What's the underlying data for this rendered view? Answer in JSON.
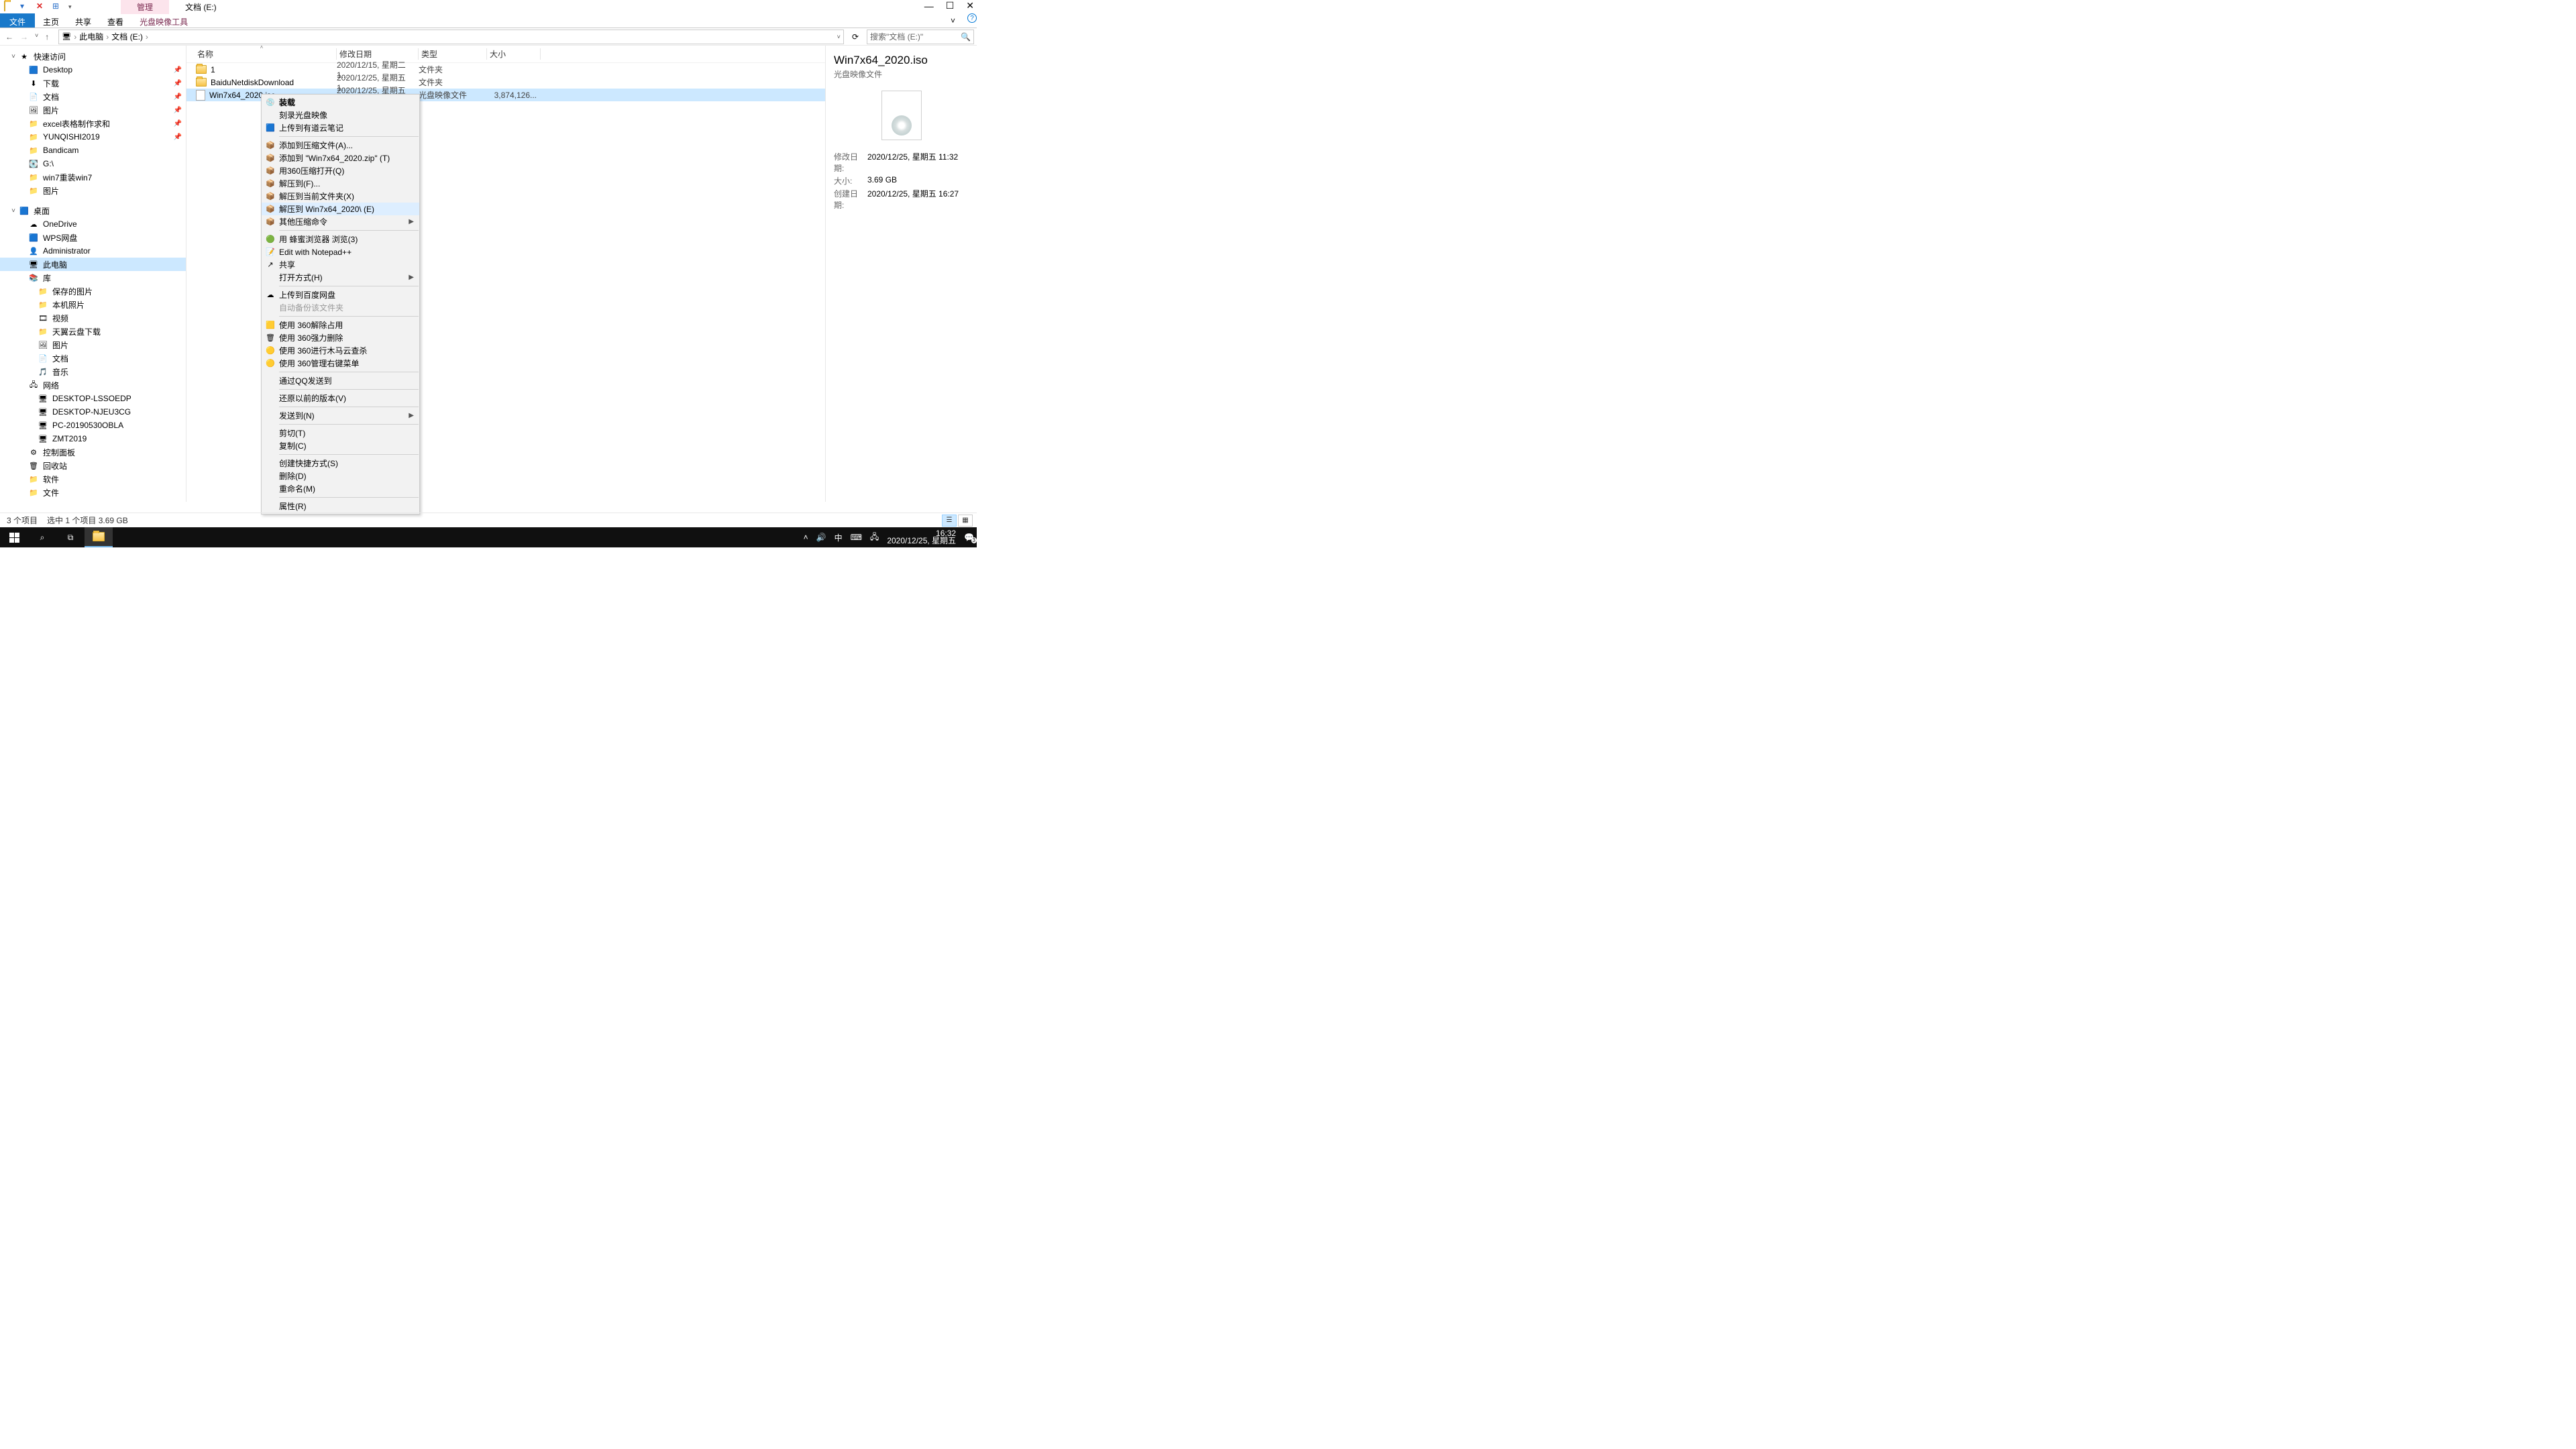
{
  "titlebar": {
    "ctx_tab": "管理",
    "window_title": "文档 (E:)"
  },
  "ribbon": {
    "file": "文件",
    "home": "主页",
    "share": "共享",
    "view": "查看",
    "disc_tools": "光盘映像工具"
  },
  "address": {
    "root": "此电脑",
    "segment": "文档 (E:)",
    "search_placeholder": "搜索\"文档 (E:)\""
  },
  "nav": {
    "quick": {
      "label": "快速访问"
    },
    "items_quick": [
      {
        "label": "Desktop",
        "icon": "🟦",
        "pin": true
      },
      {
        "label": "下载",
        "icon": "⬇",
        "pin": true
      },
      {
        "label": "文档",
        "icon": "📄",
        "pin": true
      },
      {
        "label": "图片",
        "icon": "🖼",
        "pin": true
      },
      {
        "label": "excel表格制作求和",
        "icon": "📁",
        "pin": true
      },
      {
        "label": "YUNQISHI2019",
        "icon": "📁",
        "pin": true
      },
      {
        "label": "Bandicam",
        "icon": "📁"
      },
      {
        "label": "G:\\",
        "icon": "💽"
      },
      {
        "label": "win7重装win7",
        "icon": "📁"
      },
      {
        "label": "图片",
        "icon": "📁"
      }
    ],
    "desktop": {
      "label": "桌面"
    },
    "items_desktop": [
      {
        "label": "OneDrive",
        "icon": "☁"
      },
      {
        "label": "WPS网盘",
        "icon": "🟦"
      },
      {
        "label": "Administrator",
        "icon": "👤"
      },
      {
        "label": "此电脑",
        "icon": "🖥",
        "selected": true
      },
      {
        "label": "库",
        "icon": "📚"
      },
      {
        "label": "保存的图片",
        "icon": "📁",
        "lvl": 2
      },
      {
        "label": "本机照片",
        "icon": "📁",
        "lvl": 2
      },
      {
        "label": "视频",
        "icon": "🎞",
        "lvl": 2
      },
      {
        "label": "天翼云盘下载",
        "icon": "📁",
        "lvl": 2
      },
      {
        "label": "图片",
        "icon": "🖼",
        "lvl": 2
      },
      {
        "label": "文档",
        "icon": "📄",
        "lvl": 2
      },
      {
        "label": "音乐",
        "icon": "🎵",
        "lvl": 2
      },
      {
        "label": "网络",
        "icon": "🖧"
      },
      {
        "label": "DESKTOP-LSSOEDP",
        "icon": "🖥",
        "lvl": 2
      },
      {
        "label": "DESKTOP-NJEU3CG",
        "icon": "🖥",
        "lvl": 2
      },
      {
        "label": "PC-20190530OBLA",
        "icon": "🖥",
        "lvl": 2
      },
      {
        "label": "ZMT2019",
        "icon": "🖥",
        "lvl": 2
      },
      {
        "label": "控制面板",
        "icon": "⚙"
      },
      {
        "label": "回收站",
        "icon": "🗑"
      },
      {
        "label": "软件",
        "icon": "📁"
      },
      {
        "label": "文件",
        "icon": "📁"
      }
    ]
  },
  "columns": {
    "name": "名称",
    "date": "修改日期",
    "type": "类型",
    "size": "大小"
  },
  "rows": [
    {
      "name": "1",
      "date": "2020/12/15, 星期二 1...",
      "type": "文件夹",
      "size": "",
      "icon": "folder"
    },
    {
      "name": "BaiduNetdiskDownload",
      "date": "2020/12/25, 星期五 1...",
      "type": "文件夹",
      "size": "",
      "icon": "folder"
    },
    {
      "name": "Win7x64_2020.iso",
      "date": "2020/12/25, 星期五 1...",
      "type": "光盘映像文件",
      "size": "3,874,126...",
      "icon": "file",
      "selected": true
    }
  ],
  "details": {
    "title": "Win7x64_2020.iso",
    "subtitle": "光盘映像文件",
    "mdate_l": "修改日期:",
    "mdate": "2020/12/25, 星期五 11:32",
    "size_l": "大小:",
    "size": "3.69 GB",
    "cdate_l": "创建日期:",
    "cdate": "2020/12/25, 星期五 16:27"
  },
  "ctx": [
    {
      "label": "装载",
      "bold": true,
      "icon": "💿"
    },
    {
      "label": "刻录光盘映像"
    },
    {
      "label": "上传到有道云笔记",
      "icon": "🟦"
    },
    {
      "sep": true
    },
    {
      "label": "添加到压缩文件(A)...",
      "icon": "📦"
    },
    {
      "label": "添加到 \"Win7x64_2020.zip\" (T)",
      "icon": "📦"
    },
    {
      "label": "用360压缩打开(Q)",
      "icon": "📦"
    },
    {
      "label": "解压到(F)...",
      "icon": "📦"
    },
    {
      "label": "解压到当前文件夹(X)",
      "icon": "📦"
    },
    {
      "label": "解压到 Win7x64_2020\\ (E)",
      "icon": "📦",
      "hovered": true
    },
    {
      "label": "其他压缩命令",
      "icon": "📦",
      "submenu": true
    },
    {
      "sep": true
    },
    {
      "label": "用 蜂蜜浏览器 浏览(3)",
      "icon": "🟢"
    },
    {
      "label": "Edit with Notepad++",
      "icon": "📝"
    },
    {
      "label": "共享",
      "icon": "↗"
    },
    {
      "label": "打开方式(H)",
      "submenu": true
    },
    {
      "sep": true
    },
    {
      "label": "上传到百度网盘",
      "icon": "☁"
    },
    {
      "label": "自动备份该文件夹",
      "disabled": true
    },
    {
      "sep": true
    },
    {
      "label": "使用 360解除占用",
      "icon": "🟨"
    },
    {
      "label": "使用 360强力删除",
      "icon": "🗑"
    },
    {
      "label": "使用 360进行木马云查杀",
      "icon": "🟡"
    },
    {
      "label": "使用 360管理右键菜单",
      "icon": "🟡"
    },
    {
      "sep": true
    },
    {
      "label": "通过QQ发送到"
    },
    {
      "sep": true
    },
    {
      "label": "还原以前的版本(V)"
    },
    {
      "sep": true
    },
    {
      "label": "发送到(N)",
      "submenu": true
    },
    {
      "sep": true
    },
    {
      "label": "剪切(T)"
    },
    {
      "label": "复制(C)"
    },
    {
      "sep": true
    },
    {
      "label": "创建快捷方式(S)"
    },
    {
      "label": "删除(D)"
    },
    {
      "label": "重命名(M)"
    },
    {
      "sep": true
    },
    {
      "label": "属性(R)"
    }
  ],
  "status": {
    "count": "3 个项目",
    "selected": "选中 1 个项目  3.69 GB"
  },
  "taskbar": {
    "tray_chevron": "˄",
    "ime": "中",
    "time": "16:32",
    "date": "2020/12/25, 星期五",
    "notif": "3"
  }
}
